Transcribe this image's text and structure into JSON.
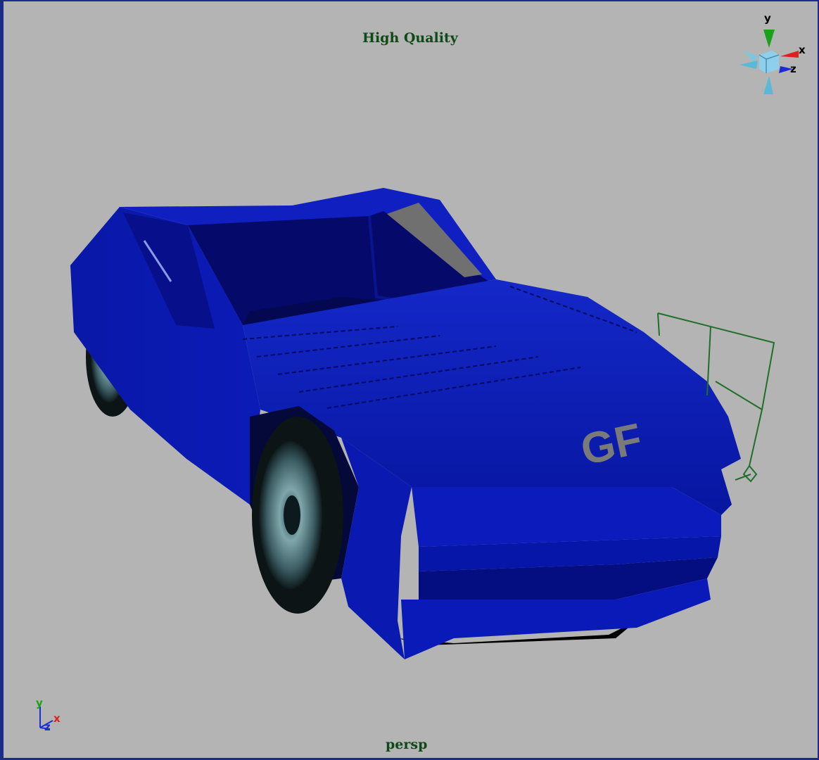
{
  "viewport": {
    "renderer_label": "High Quality",
    "camera_label": "persp",
    "background_color": "#b4b4b4",
    "border_color": "#1c2a8c"
  },
  "model": {
    "name_icon": "sports-car-model",
    "body_color": "#0a1bb8",
    "hood_decal": "GF",
    "selected_object": "green wireframe locator"
  },
  "view_cube": {
    "icon": "view-cube-icon",
    "labels": {
      "y": "y",
      "x": "x",
      "z": "z"
    }
  },
  "axis_indicator": {
    "icon": "axis-triad-icon",
    "labels": {
      "y": "y",
      "x": "x",
      "z": "z"
    },
    "colors": {
      "y": "#1aa01a",
      "x": "#e02020",
      "z": "#2030d0"
    }
  }
}
